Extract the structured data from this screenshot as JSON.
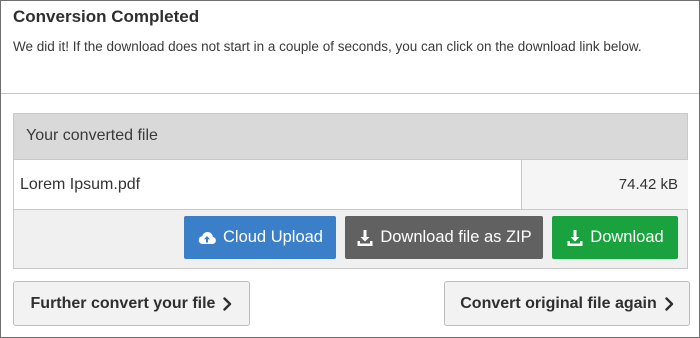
{
  "dialog": {
    "title": "Conversion Completed",
    "message": "We did it! If the download does not start in a couple of seconds, you can click on the download link below."
  },
  "file_panel": {
    "header": "Your converted file",
    "file_name": "Lorem Ipsum.pdf",
    "file_size": "74.42 kB"
  },
  "actions": {
    "cloud_upload": {
      "label": "Cloud Upload",
      "icon": "cloud-upload-icon",
      "color": "#3a7fc7"
    },
    "download_zip": {
      "label": "Download file as ZIP",
      "icon": "download-icon",
      "color": "#616161"
    },
    "download": {
      "label": "Download",
      "icon": "download-icon",
      "color": "#1aa23f"
    }
  },
  "footer": {
    "further_convert": "Further convert your file",
    "convert_again": "Convert original file again"
  }
}
